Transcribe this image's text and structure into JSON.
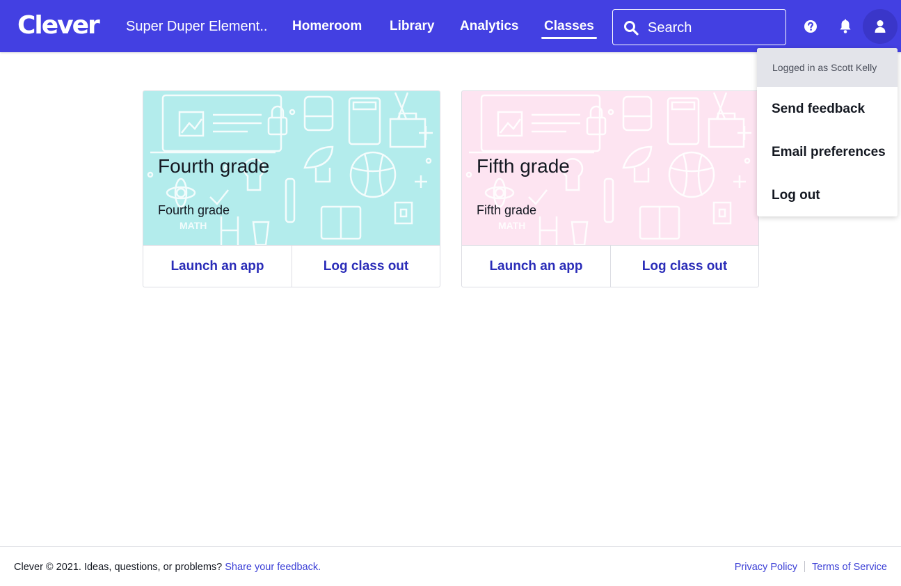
{
  "header": {
    "logo": "Clever",
    "school_name": "Super Duper Element...",
    "nav": [
      {
        "label": "Homeroom",
        "active": false
      },
      {
        "label": "Library",
        "active": false
      },
      {
        "label": "Analytics",
        "active": false
      },
      {
        "label": "Classes",
        "active": true
      }
    ],
    "search": {
      "placeholder": "Search",
      "icon": "search-icon"
    },
    "icons": [
      "help-icon",
      "bell-icon",
      "user-icon"
    ],
    "brand_color": "#4340e2"
  },
  "cards": [
    {
      "title": "Fourth grade",
      "subtitle": "Fourth grade",
      "banner_color": "#b3ecec",
      "banner_label": "MATH",
      "launch_label": "Launch an app",
      "logout_label": "Log class out"
    },
    {
      "title": "Fifth grade",
      "subtitle": "Fifth grade",
      "banner_color": "#fde4f1",
      "banner_label": "MATH",
      "launch_label": "Launch an app",
      "logout_label": "Log class out"
    }
  ],
  "dropdown": {
    "logged_in": "Logged in as Scott Kelly",
    "items": [
      "Send feedback",
      "Email preferences",
      "Log out"
    ]
  },
  "footer": {
    "text": "Clever © 2021. Ideas, questions, or problems?",
    "feedback_link": "Share your feedback",
    "period": ".",
    "privacy": "Privacy Policy",
    "terms": "Terms of Service"
  }
}
